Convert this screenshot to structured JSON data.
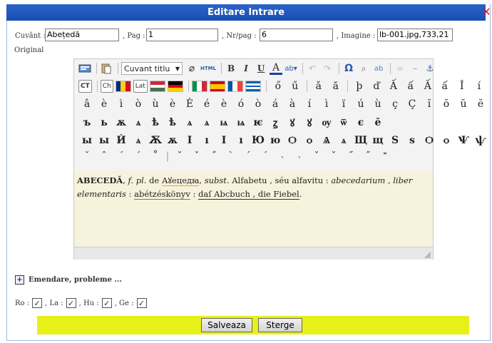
{
  "dialog": {
    "title": "Editare Intrare",
    "close_icon": "close-icon"
  },
  "fields": {
    "cuvant_label": "Cuvânt :",
    "cuvant_value": "Abețedă",
    "pag_label": ", Pag :",
    "pag_value": "1",
    "nrpag_label": ", Nr/pag :",
    "nrpag_value": "6",
    "imagine_label": ", Imagine :",
    "imagine_value": "lb-001.jpg,733,21"
  },
  "original_label": "Original",
  "toolbar": {
    "format_select": "Cuvant titlu",
    "html_label": "HTML",
    "bold": "B",
    "italic": "I",
    "underline": "U",
    "font_color": "A",
    "omega": "Ω",
    "ct_btn": "CT",
    "ch_btn": "Ch",
    "lat_btn": "Lat"
  },
  "special_chars_row1": [
    "ő",
    "ű",
    "ǎ",
    "ă",
    "þ",
    "ď",
    "Ấ",
    "ấ",
    "Ấ",
    "ấ",
    "Î",
    "í"
  ],
  "special_chars_row2": [
    "â",
    "è",
    "ì",
    "ò",
    "ù",
    "è",
    "Ė",
    "é",
    "è",
    "ó",
    "ò",
    "á",
    "à",
    "í",
    "ì",
    "ï",
    "ú",
    "ù",
    "ç",
    "Ç",
    "ĭ",
    "ŏ",
    "ŭ",
    "ĕ"
  ],
  "special_chars_row3": [
    "ъ",
    "ь",
    "ѫ",
    "ѧ",
    "ѣ",
    "ѣ",
    "ѧ",
    "ѧ",
    "ѩ",
    "ѩ",
    "ѥ",
    "ꙁ",
    "ꙋ",
    "ꙋ",
    "ѹ",
    "ѿ",
    "є",
    "ē"
  ],
  "special_chars_row4": [
    "ы",
    "ы",
    "Ѝ",
    "ѧ",
    "Ѫ",
    "ѫ",
    "І",
    "ı",
    "І",
    "ı",
    "Ю",
    "ю",
    "Ѻ",
    "ѻ",
    "Ѧ",
    "ѧ",
    "Щ",
    "щ",
    "Ѕ",
    "ѕ",
    "Ѻ",
    "ѻ",
    "Ѱ",
    "ѱ"
  ],
  "special_chars_row5": [
    "˘",
    "ˆ",
    "´",
    "ˊ",
    "˚",
    "|",
    "ˇ",
    "ˇ",
    "˝",
    "ˋ",
    "ˊ",
    "ˊ",
    "˴",
    "˴",
    "ˇ",
    "ˇ",
    "˝",
    "˝",
    "˭"
  ],
  "content": {
    "headword": "ABECEDĂ",
    "grammar": "f. pl.",
    "de": "de",
    "cyrillic": "Аꙋецедꙗ",
    "subst": "subst.",
    "alfabetu": "Alfabetu , séu alfavitu :",
    "latin": "abecedarium , liber elementaris",
    "colon1": ":",
    "hungarian": "abétzéskönyv",
    "colon2": ":",
    "german": "daſ Abcbuch , die Fiebel",
    "dot": "."
  },
  "emendare": "Emendare, probleme ...",
  "langs": {
    "ro": "Ro :",
    "la": ", La :",
    "hu": ", Hu :",
    "ge": ", Ge :"
  },
  "buttons": {
    "save": "Salveaza",
    "delete": "Sterge"
  },
  "colors": {
    "title_bg": "#1a4fb3",
    "button_bar": "#e8f019",
    "content_bg": "#f7f2dc"
  }
}
